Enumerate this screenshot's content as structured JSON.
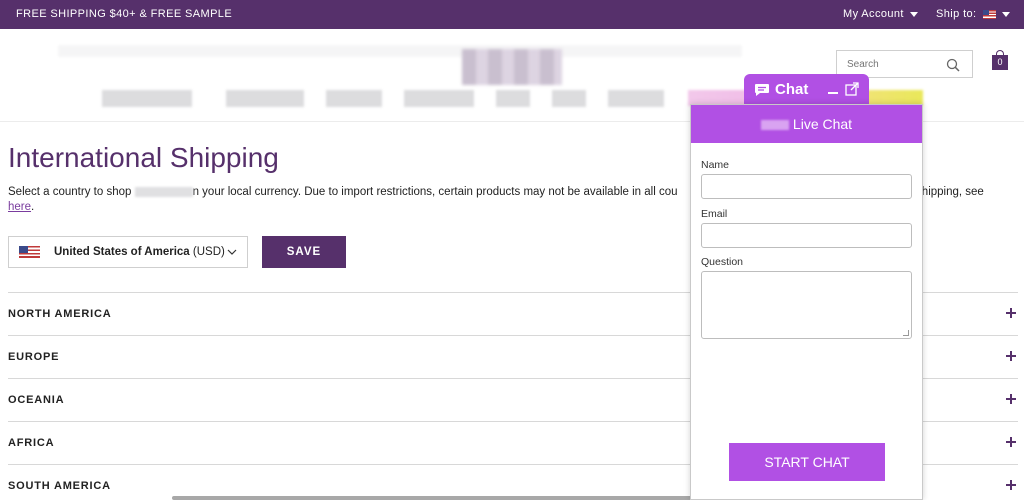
{
  "topbar": {
    "promo": "FREE SHIPPING $40+ & FREE SAMPLE",
    "account_label": "My Account",
    "ship_to_label": "Ship to:"
  },
  "header": {
    "search_placeholder": "Search",
    "cart_count": "0"
  },
  "main": {
    "title": "International Shipping",
    "desc_part1": "Select a country to shop ",
    "desc_part2": "n your local currency. Due to import restrictions, certain products may not be available in all cou",
    "desc_part3": "nal shipping, see",
    "desc_link": "here",
    "desc_end": ".",
    "country": "United States of America",
    "currency": "(USD)",
    "save_label": "SAVE",
    "regions": [
      "NORTH AMERICA",
      "EUROPE",
      "OCEANIA",
      "AFRICA",
      "SOUTH AMERICA"
    ]
  },
  "chat": {
    "tab_label": "Chat",
    "header_label": "Live Chat",
    "name_label": "Name",
    "email_label": "Email",
    "question_label": "Question",
    "start_label": "START CHAT"
  },
  "colors": {
    "brand_purple": "#56306b",
    "chat_purple": "#b150e4"
  },
  "icons": [
    "flag-us-icon",
    "search-icon",
    "shopping-bag-icon",
    "chevron-down-icon",
    "plus-icon",
    "chat-bubble-icon",
    "minimize-icon",
    "popout-icon"
  ]
}
